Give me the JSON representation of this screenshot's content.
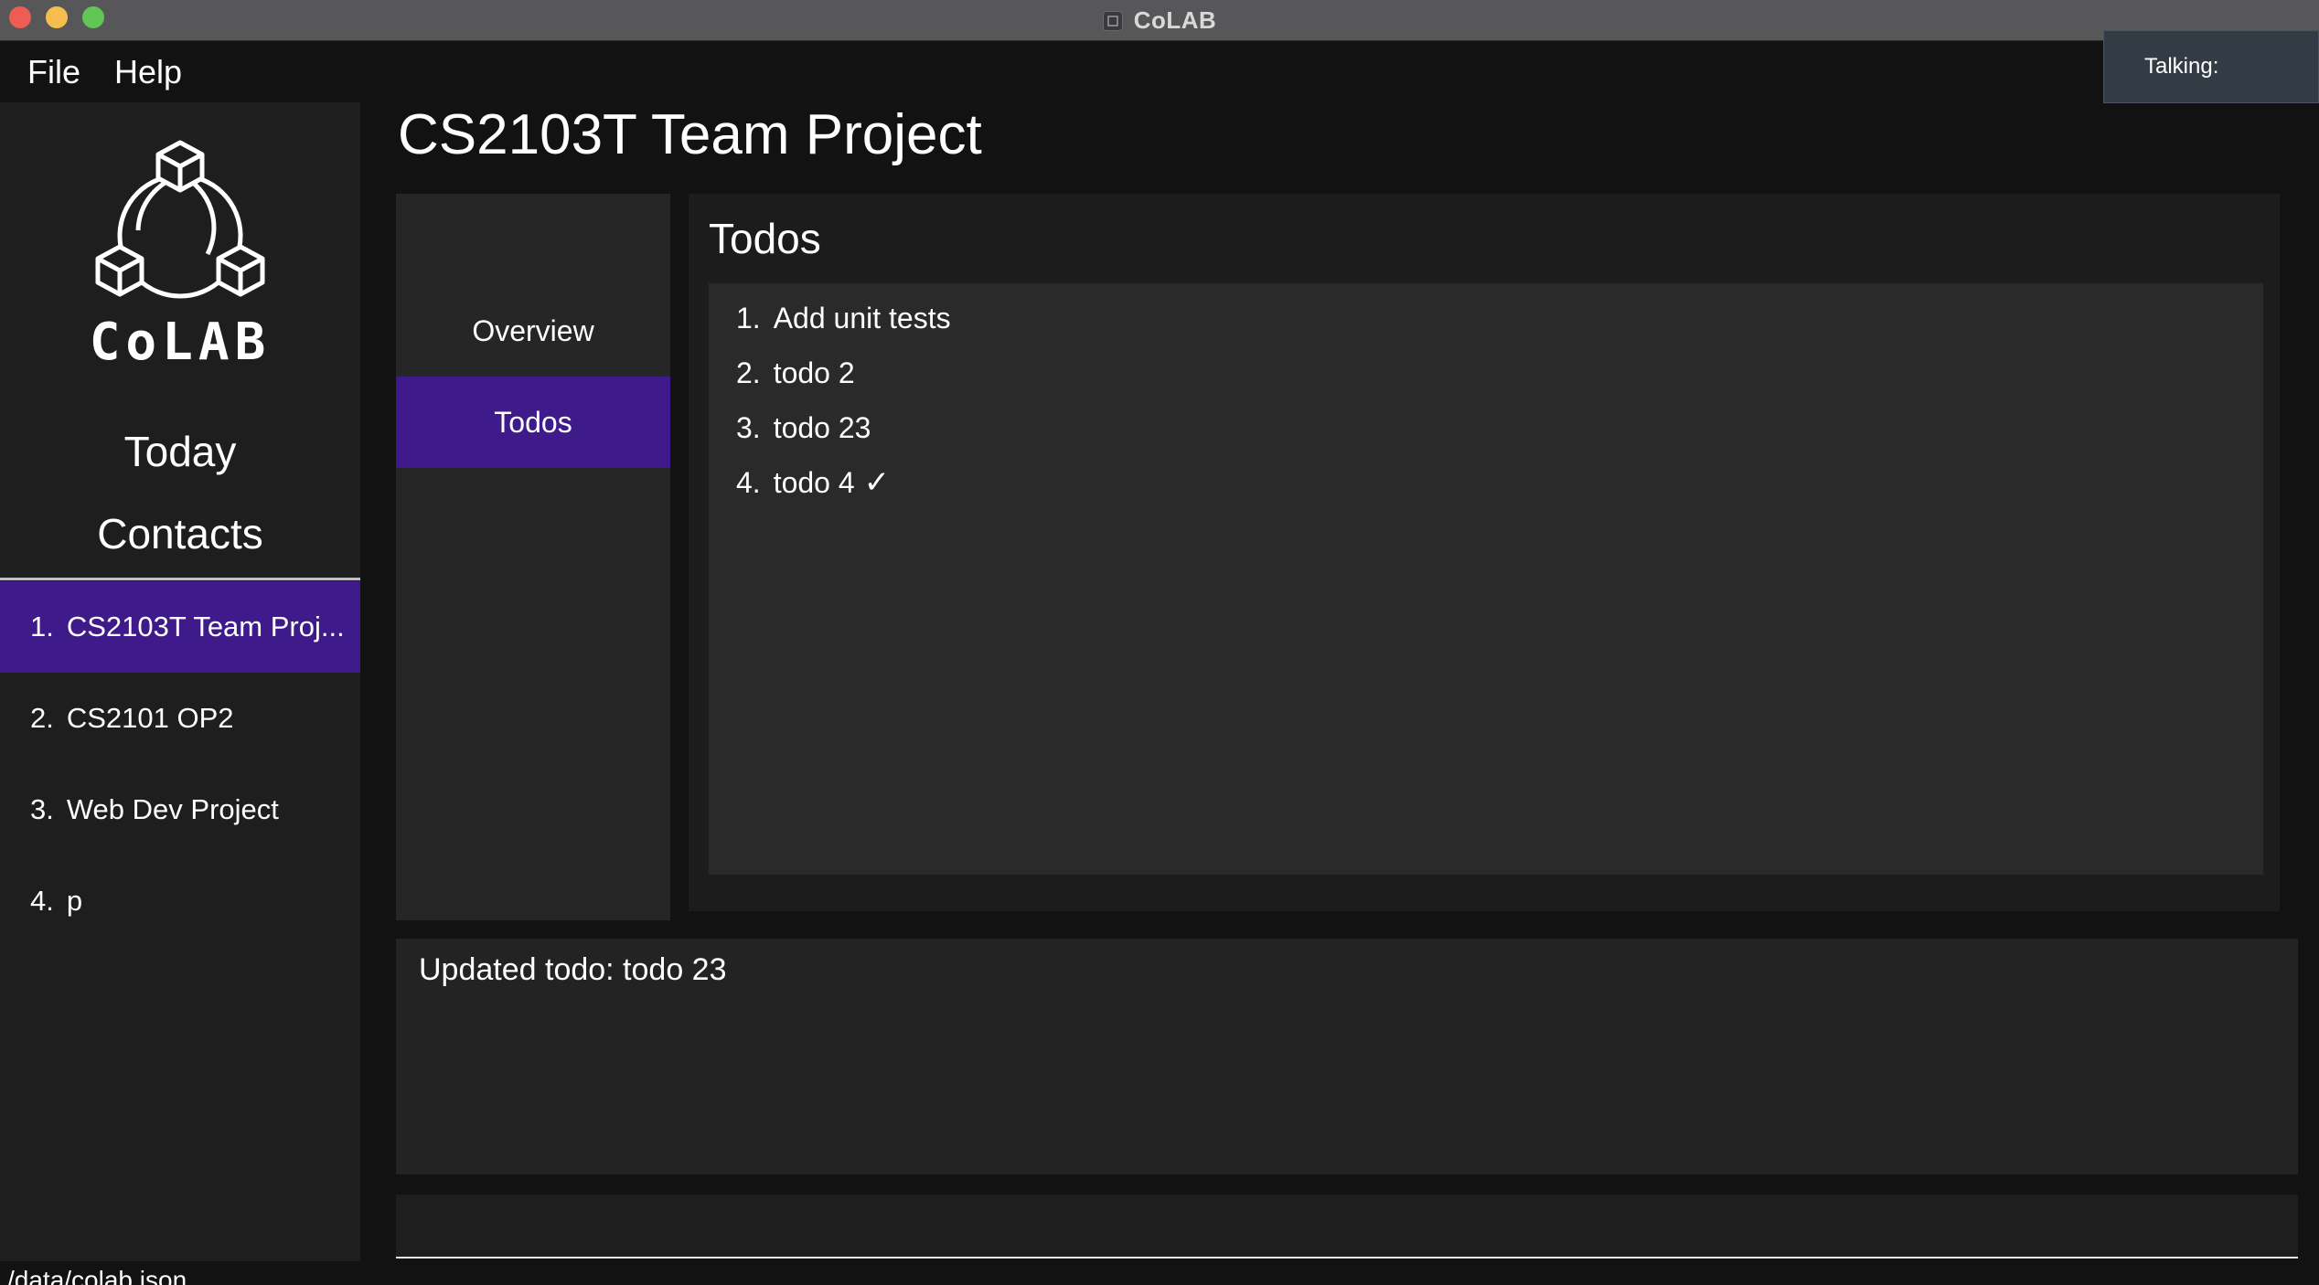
{
  "window": {
    "title": "CoLAB"
  },
  "menu": {
    "file_label": "File",
    "help_label": "Help"
  },
  "talking": {
    "label": "Talking:"
  },
  "sidebar": {
    "logo_text": "CoLAB",
    "today_label": "Today",
    "contacts_label": "Contacts",
    "projects": [
      {
        "num": "1.",
        "name": "CS2103T Team Proj..."
      },
      {
        "num": "2.",
        "name": "CS2101 OP2"
      },
      {
        "num": "3.",
        "name": "Web Dev Project"
      },
      {
        "num": "4.",
        "name": "p"
      }
    ],
    "selected_index": 0
  },
  "main": {
    "title": "CS2103T Team Project",
    "tabs": [
      {
        "label": "Overview"
      },
      {
        "label": "Todos"
      }
    ],
    "active_tab": "Todos",
    "content_title": "Todos",
    "todos": [
      {
        "num": "1.",
        "text": "Add unit tests",
        "done": false
      },
      {
        "num": "2.",
        "text": "todo 2",
        "done": false
      },
      {
        "num": "3.",
        "text": "todo 23",
        "done": false
      },
      {
        "num": "4.",
        "text": "todo 4",
        "done": true,
        "check": "✓"
      }
    ]
  },
  "result": {
    "text": "Updated todo: todo 23"
  },
  "command": {
    "value": ""
  },
  "status": {
    "path": "/data/colab.json"
  },
  "colors": {
    "accent": "#3f1a8a",
    "background": "#121212",
    "panel": "#1e1e1e",
    "titlebar": "#57575a"
  }
}
